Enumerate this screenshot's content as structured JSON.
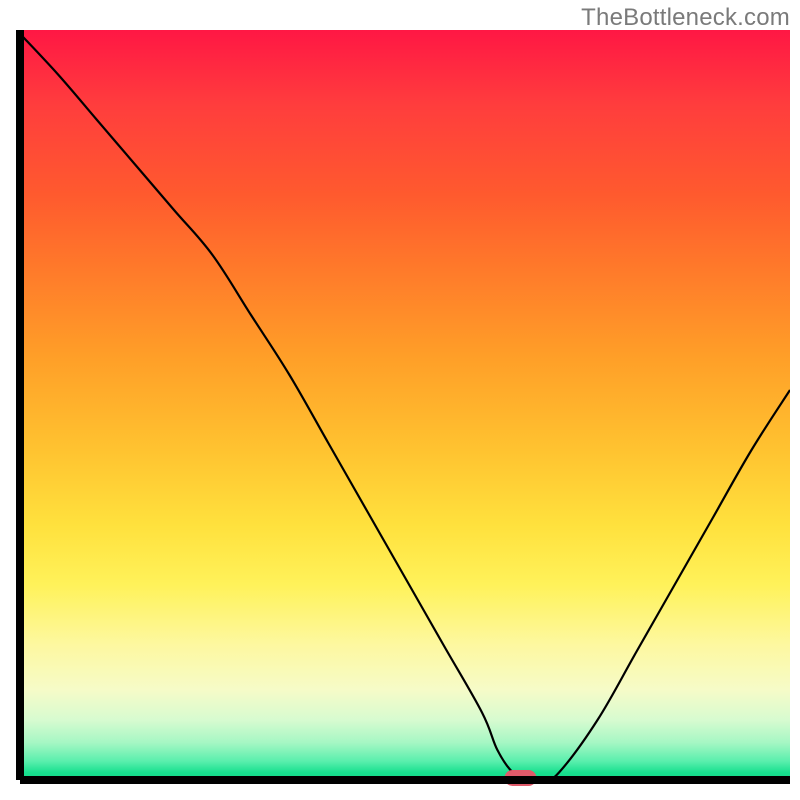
{
  "attribution": "TheBottleneck.com",
  "chart_data": {
    "type": "line",
    "title": "",
    "xlabel": "",
    "ylabel": "",
    "xlim": [
      0,
      100
    ],
    "ylim": [
      0,
      100
    ],
    "x": [
      0,
      5,
      10,
      15,
      20,
      25,
      30,
      35,
      40,
      45,
      50,
      55,
      60,
      62,
      64,
      66,
      68,
      70,
      75,
      80,
      85,
      90,
      95,
      100
    ],
    "values": [
      99.5,
      94,
      88,
      82,
      76,
      70,
      62,
      54,
      45,
      36,
      27,
      18,
      9,
      4,
      1,
      0,
      0,
      1,
      8,
      17,
      26,
      35,
      44,
      52
    ],
    "gradient_bands": [
      {
        "color": "#ff1744",
        "pos": 0.0
      },
      {
        "color": "#ff3d3d",
        "pos": 0.1
      },
      {
        "color": "#ff5a2e",
        "pos": 0.22
      },
      {
        "color": "#ff7a2a",
        "pos": 0.32
      },
      {
        "color": "#ffa028",
        "pos": 0.44
      },
      {
        "color": "#ffc330",
        "pos": 0.56
      },
      {
        "color": "#ffe13d",
        "pos": 0.66
      },
      {
        "color": "#fff25a",
        "pos": 0.74
      },
      {
        "color": "#fdf8a0",
        "pos": 0.82
      },
      {
        "color": "#f6fbc8",
        "pos": 0.88
      },
      {
        "color": "#d7fbd0",
        "pos": 0.92
      },
      {
        "color": "#a6f7c4",
        "pos": 0.95
      },
      {
        "color": "#5aefad",
        "pos": 0.975
      },
      {
        "color": "#18e08f",
        "pos": 0.99
      },
      {
        "color": "#14d987",
        "pos": 1.0
      }
    ],
    "marker": {
      "x": 65,
      "y": 0,
      "color": "#e05a6a"
    },
    "axes_color": "#000000",
    "line_color": "#000000"
  }
}
